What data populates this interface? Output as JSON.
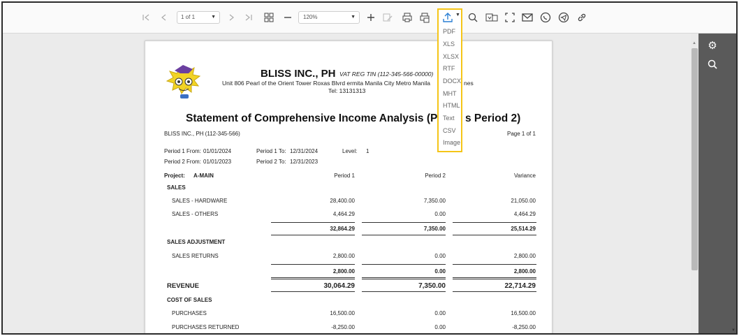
{
  "toolbar": {
    "page_select": "1 of 1",
    "zoom_select": "120%"
  },
  "export_menu": {
    "items": [
      "PDF",
      "XLS",
      "XLSX",
      "RTF",
      "DOCX",
      "MHT",
      "HTML",
      "Text",
      "CSV",
      "Image"
    ]
  },
  "report": {
    "company_name": "BLISS INC., PH",
    "vat": "VAT REG TIN (112-345-566-00000)",
    "address": "Unit 806 Pearl of the Orient Tower Roxas Blvrd ermita Manila City Metro Manila",
    "address_tail": "nes",
    "tel": "Tel: 13131313",
    "title_left": "Statement of Comprehensive Income Analysis (Perio",
    "title_right": "s Period 2)",
    "company_line": "BLISS INC., PH (112-345-566)",
    "page_label": "Page 1 of 1",
    "period1_from_label": "Period 1 From:",
    "period1_from": "01/01/2024",
    "period1_to_label": "Period 1 To:",
    "period1_to": "12/31/2024",
    "level_label": "Level:",
    "level": "1",
    "period2_from_label": "Period 2 From:",
    "period2_from": "01/01/2023",
    "period2_to_label": "Period 2 To:",
    "period2_to": "12/31/2023",
    "project_label": "Project:",
    "project": "A-MAIN",
    "col_period1": "Period 1",
    "col_period2": "Period 2",
    "col_variance": "Variance",
    "rows": {
      "sales_header": "SALES",
      "sales_hardware": {
        "label": "SALES - HARDWARE",
        "p1": "28,400.00",
        "p2": "7,350.00",
        "var": "21,050.00"
      },
      "sales_others": {
        "label": "SALES - OTHERS",
        "p1": "4,464.29",
        "p2": "0.00",
        "var": "4,464.29"
      },
      "sales_total": {
        "p1": "32,864.29",
        "p2": "7,350.00",
        "var": "25,514.29"
      },
      "adj_header": "SALES ADJUSTMENT",
      "sales_returns": {
        "label": "SALES RETURNS",
        "p1": "2,800.00",
        "p2": "0.00",
        "var": "2,800.00"
      },
      "adj_total": {
        "p1": "2,800.00",
        "p2": "0.00",
        "var": "2,800.00"
      },
      "revenue": {
        "label": "REVENUE",
        "p1": "30,064.29",
        "p2": "7,350.00",
        "var": "22,714.29"
      },
      "cos_header": "COST OF SALES",
      "purchases": {
        "label": "PURCHASES",
        "p1": "16,500.00",
        "p2": "0.00",
        "var": "16,500.00"
      },
      "purchases_returned": {
        "label": "PURCHASES RETURNED",
        "p1": "-8,250.00",
        "p2": "0.00",
        "var": "-8,250.00"
      }
    }
  }
}
